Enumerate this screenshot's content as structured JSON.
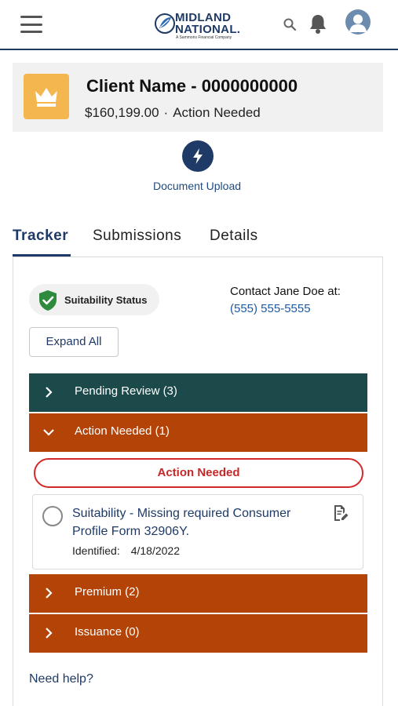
{
  "header": {
    "menu_icon": "hamburger-menu-icon",
    "logo": {
      "line1": "MIDLAND",
      "line2": "NATIONAL.",
      "tagline": "A Sammons Financial Company"
    },
    "search_icon": "search-icon",
    "bell_icon": "notification-bell-icon",
    "avatar_icon": "user-avatar-icon"
  },
  "client": {
    "name": "Client Name - 0000000000",
    "amount": "$160,199.00",
    "separator": "·",
    "status": "Action Needed",
    "icon": "crown-icon",
    "icon_bg_color": "#f4b64f"
  },
  "quick_action": {
    "label": "Document Upload",
    "icon": "lightning-bolt-icon"
  },
  "tabs": [
    {
      "label": "Tracker",
      "active": true
    },
    {
      "label": "Submissions",
      "active": false
    },
    {
      "label": "Details",
      "active": false
    }
  ],
  "tracker": {
    "suitability_label": "Suitability Status",
    "suitability_icon": "check-shield-icon",
    "contact_text": "Contact Jane Doe at:",
    "contact_phone": "(555) 555-5555",
    "expand_all_label": "Expand All",
    "sections": [
      {
        "label": "Pending Review (3)",
        "expanded": false,
        "color": "#1c4a4a"
      },
      {
        "label": "Action Needed (1)",
        "expanded": true,
        "color": "#b44308"
      },
      {
        "label": "Premium (2)",
        "expanded": false,
        "color": "#b44308"
      },
      {
        "label": "Issuance (0)",
        "expanded": false,
        "color": "#b44308"
      }
    ],
    "action_needed_pill": "Action Needed",
    "task": {
      "title": "Suitability - Missing required Consumer Profile Form 32906Y.",
      "identified_label": "Identified:",
      "identified_value": "4/18/2022",
      "icon": "document-edit-icon"
    },
    "need_help": "Need help?"
  },
  "colors": {
    "brand_navy": "#1f3a66",
    "teal": "#1c4a4a",
    "orange": "#b44308",
    "alert_red": "#d22a2a",
    "success_green": "#2e8b3e"
  }
}
